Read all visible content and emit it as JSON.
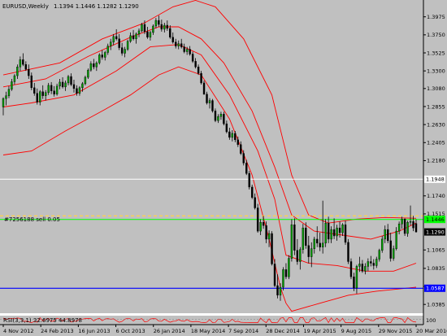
{
  "header": {
    "symbol": "EURUSD,Weekly",
    "ohlc": "1.1394 1.1446 1.1282 1.1290"
  },
  "chart_data": {
    "type": "candlestick",
    "y_ticks": [
      "1.3975",
      "1.3750",
      "1.3525",
      "1.3300",
      "1.3080",
      "1.2855",
      "1.2630",
      "1.2405",
      "1.2180",
      "1.1740",
      "1.1515",
      "1.1065",
      "1.0835",
      "1.0610",
      "1.0385"
    ],
    "x_ticks": [
      "4 Nov 2012",
      "24 Feb 2013",
      "16 Jun 2013",
      "6 Oct 2013",
      "26 Jan 2014",
      "18 May 2014",
      "7 Sep 2014",
      "28 Dec 2014",
      "19 Apr 2015",
      "9 Aug 2015",
      "29 Nov 2015",
      "20 Mar 2016"
    ],
    "ylim": [
      1.0265,
      1.4185
    ],
    "candles": [
      [
        1.285,
        1.297,
        1.2745,
        1.2955
      ],
      [
        1.2955,
        1.304,
        1.287,
        1.299
      ],
      [
        1.299,
        1.311,
        1.296,
        1.307
      ],
      [
        1.307,
        1.32,
        1.305,
        1.3165
      ],
      [
        1.3165,
        1.326,
        1.313,
        1.324
      ],
      [
        1.324,
        1.338,
        1.32,
        1.335
      ],
      [
        1.335,
        1.348,
        1.33,
        1.344
      ],
      [
        1.344,
        1.352,
        1.336,
        1.338
      ],
      [
        1.338,
        1.342,
        1.33,
        1.332
      ],
      [
        1.332,
        1.338,
        1.32,
        1.324
      ],
      [
        1.324,
        1.328,
        1.306,
        1.309
      ],
      [
        1.309,
        1.315,
        1.299,
        1.302
      ],
      [
        1.302,
        1.308,
        1.288,
        1.291
      ],
      [
        1.291,
        1.306,
        1.287,
        1.304
      ],
      [
        1.304,
        1.312,
        1.295,
        1.299
      ],
      [
        1.299,
        1.306,
        1.293,
        1.303
      ],
      [
        1.303,
        1.315,
        1.3,
        1.312
      ],
      [
        1.312,
        1.316,
        1.301,
        1.305
      ],
      [
        1.305,
        1.311,
        1.298,
        1.301
      ],
      [
        1.301,
        1.314,
        1.299,
        1.311
      ],
      [
        1.311,
        1.32,
        1.307,
        1.316
      ],
      [
        1.316,
        1.322,
        1.308,
        1.31
      ],
      [
        1.31,
        1.318,
        1.305,
        1.315
      ],
      [
        1.315,
        1.325,
        1.312,
        1.323
      ],
      [
        1.323,
        1.327,
        1.311,
        1.313
      ],
      [
        1.313,
        1.319,
        1.303,
        1.308
      ],
      [
        1.308,
        1.312,
        1.299,
        1.302
      ],
      [
        1.302,
        1.311,
        1.299,
        1.309
      ],
      [
        1.309,
        1.316,
        1.304,
        1.314
      ],
      [
        1.314,
        1.324,
        1.312,
        1.322
      ],
      [
        1.322,
        1.333,
        1.32,
        1.331
      ],
      [
        1.331,
        1.342,
        1.329,
        1.339
      ],
      [
        1.339,
        1.345,
        1.332,
        1.335
      ],
      [
        1.335,
        1.342,
        1.33,
        1.34
      ],
      [
        1.34,
        1.352,
        1.338,
        1.35
      ],
      [
        1.35,
        1.356,
        1.344,
        1.347
      ],
      [
        1.347,
        1.355,
        1.343,
        1.353
      ],
      [
        1.353,
        1.364,
        1.35,
        1.361
      ],
      [
        1.361,
        1.37,
        1.356,
        1.366
      ],
      [
        1.366,
        1.376,
        1.362,
        1.373
      ],
      [
        1.373,
        1.382,
        1.368,
        1.37
      ],
      [
        1.37,
        1.376,
        1.356,
        1.359
      ],
      [
        1.359,
        1.365,
        1.349,
        1.352
      ],
      [
        1.352,
        1.36,
        1.347,
        1.357
      ],
      [
        1.357,
        1.369,
        1.355,
        1.367
      ],
      [
        1.367,
        1.378,
        1.365,
        1.374
      ],
      [
        1.374,
        1.381,
        1.368,
        1.37
      ],
      [
        1.37,
        1.378,
        1.364,
        1.376
      ],
      [
        1.376,
        1.383,
        1.372,
        1.38
      ],
      [
        1.38,
        1.39,
        1.378,
        1.388
      ],
      [
        1.388,
        1.393,
        1.376,
        1.379
      ],
      [
        1.379,
        1.385,
        1.37,
        1.372
      ],
      [
        1.372,
        1.38,
        1.368,
        1.378
      ],
      [
        1.378,
        1.388,
        1.375,
        1.386
      ],
      [
        1.386,
        1.396,
        1.383,
        1.393
      ],
      [
        1.393,
        1.399,
        1.385,
        1.388
      ],
      [
        1.388,
        1.394,
        1.379,
        1.382
      ],
      [
        1.382,
        1.39,
        1.378,
        1.387
      ],
      [
        1.387,
        1.393,
        1.38,
        1.383
      ],
      [
        1.383,
        1.387,
        1.37,
        1.372
      ],
      [
        1.372,
        1.378,
        1.364,
        1.366
      ],
      [
        1.366,
        1.37,
        1.358,
        1.361
      ],
      [
        1.361,
        1.368,
        1.357,
        1.364
      ],
      [
        1.364,
        1.37,
        1.358,
        1.36
      ],
      [
        1.36,
        1.364,
        1.352,
        1.354
      ],
      [
        1.354,
        1.36,
        1.35,
        1.357
      ],
      [
        1.357,
        1.361,
        1.349,
        1.351
      ],
      [
        1.351,
        1.354,
        1.34,
        1.342
      ],
      [
        1.342,
        1.346,
        1.333,
        1.335
      ],
      [
        1.335,
        1.338,
        1.325,
        1.327
      ],
      [
        1.327,
        1.33,
        1.313,
        1.315
      ],
      [
        1.315,
        1.318,
        1.3,
        1.301
      ],
      [
        1.301,
        1.304,
        1.288,
        1.29
      ],
      [
        1.29,
        1.296,
        1.283,
        1.293
      ],
      [
        1.293,
        1.295,
        1.278,
        1.28
      ],
      [
        1.28,
        1.283,
        1.266,
        1.268
      ],
      [
        1.268,
        1.276,
        1.265,
        1.273
      ],
      [
        1.273,
        1.279,
        1.269,
        1.276
      ],
      [
        1.276,
        1.279,
        1.262,
        1.264
      ],
      [
        1.264,
        1.268,
        1.252,
        1.254
      ],
      [
        1.254,
        1.259,
        1.244,
        1.247
      ],
      [
        1.247,
        1.256,
        1.242,
        1.252
      ],
      [
        1.252,
        1.255,
        1.241,
        1.244
      ],
      [
        1.244,
        1.248,
        1.235,
        1.238
      ],
      [
        1.238,
        1.242,
        1.225,
        1.227
      ],
      [
        1.227,
        1.231,
        1.212,
        1.215
      ],
      [
        1.215,
        1.219,
        1.2,
        1.202
      ],
      [
        1.202,
        1.205,
        1.182,
        1.185
      ],
      [
        1.185,
        1.188,
        1.17,
        1.172
      ],
      [
        1.172,
        1.177,
        1.157,
        1.159
      ],
      [
        1.159,
        1.164,
        1.128,
        1.13
      ],
      [
        1.13,
        1.145,
        1.125,
        1.141
      ],
      [
        1.141,
        1.149,
        1.133,
        1.137
      ],
      [
        1.137,
        1.142,
        1.115,
        1.12
      ],
      [
        1.12,
        1.131,
        1.11,
        1.127
      ],
      [
        1.127,
        1.13,
        1.087,
        1.089
      ],
      [
        1.089,
        1.095,
        1.06,
        1.062
      ],
      [
        1.062,
        1.076,
        1.046,
        1.05
      ],
      [
        1.05,
        1.065,
        1.043,
        1.06
      ],
      [
        1.06,
        1.085,
        1.056,
        1.082
      ],
      [
        1.082,
        1.09,
        1.07,
        1.073
      ],
      [
        1.073,
        1.1,
        1.07,
        1.096
      ],
      [
        1.096,
        1.145,
        1.092,
        1.138
      ],
      [
        1.138,
        1.146,
        1.1,
        1.106
      ],
      [
        1.106,
        1.12,
        1.088,
        1.092
      ],
      [
        1.092,
        1.11,
        1.082,
        1.107
      ],
      [
        1.107,
        1.139,
        1.102,
        1.134
      ],
      [
        1.134,
        1.141,
        1.108,
        1.112
      ],
      [
        1.112,
        1.124,
        1.09,
        1.098
      ],
      [
        1.098,
        1.116,
        1.085,
        1.108
      ],
      [
        1.108,
        1.123,
        1.102,
        1.12
      ],
      [
        1.12,
        1.136,
        1.11,
        1.115
      ],
      [
        1.115,
        1.128,
        1.105,
        1.11
      ],
      [
        1.11,
        1.168,
        1.102,
        1.115
      ],
      [
        1.115,
        1.145,
        1.11,
        1.14
      ],
      [
        1.14,
        1.148,
        1.115,
        1.12
      ],
      [
        1.12,
        1.136,
        1.115,
        1.132
      ],
      [
        1.132,
        1.146,
        1.12,
        1.124
      ],
      [
        1.124,
        1.138,
        1.118,
        1.134
      ],
      [
        1.134,
        1.142,
        1.122,
        1.128
      ],
      [
        1.128,
        1.14,
        1.124,
        1.138
      ],
      [
        1.138,
        1.143,
        1.113,
        1.116
      ],
      [
        1.116,
        1.12,
        1.089,
        1.092
      ],
      [
        1.092,
        1.096,
        1.07,
        1.073
      ],
      [
        1.073,
        1.078,
        1.055,
        1.059
      ],
      [
        1.059,
        1.088,
        1.052,
        1.086
      ],
      [
        1.086,
        1.098,
        1.079,
        1.089
      ],
      [
        1.089,
        1.094,
        1.078,
        1.08
      ],
      [
        1.08,
        1.09,
        1.076,
        1.086
      ],
      [
        1.086,
        1.096,
        1.08,
        1.092
      ],
      [
        1.092,
        1.099,
        1.086,
        1.09
      ],
      [
        1.09,
        1.095,
        1.082,
        1.087
      ],
      [
        1.087,
        1.098,
        1.084,
        1.095
      ],
      [
        1.095,
        1.108,
        1.092,
        1.106
      ],
      [
        1.106,
        1.124,
        1.103,
        1.12
      ],
      [
        1.12,
        1.137,
        1.115,
        1.132
      ],
      [
        1.132,
        1.139,
        1.115,
        1.118
      ],
      [
        1.118,
        1.128,
        1.092,
        1.096
      ],
      [
        1.096,
        1.112,
        1.093,
        1.108
      ],
      [
        1.108,
        1.135,
        1.106,
        1.13
      ],
      [
        1.13,
        1.142,
        1.126,
        1.139
      ],
      [
        1.139,
        1.148,
        1.133,
        1.145
      ],
      [
        1.145,
        1.146,
        1.124,
        1.127
      ],
      [
        1.127,
        1.143,
        1.123,
        1.141
      ],
      [
        1.141,
        1.162,
        1.137,
        1.142
      ],
      [
        1.142,
        1.149,
        1.13,
        1.134
      ],
      [
        1.1394,
        1.1446,
        1.1282,
        1.129
      ]
    ],
    "bands": {
      "color": "#ff0000",
      "outer_upper": [
        [
          0,
          1.325
        ],
        [
          20,
          1.34
        ],
        [
          35,
          1.37
        ],
        [
          50,
          1.39
        ],
        [
          60,
          1.41
        ],
        [
          68,
          1.418
        ],
        [
          75,
          1.41
        ],
        [
          85,
          1.37
        ],
        [
          95,
          1.3
        ],
        [
          102,
          1.2
        ],
        [
          108,
          1.15
        ],
        [
          115,
          1.14
        ],
        [
          125,
          1.145
        ],
        [
          135,
          1.147
        ],
        [
          146,
          1.146
        ]
      ],
      "inner_upper": [
        [
          0,
          1.31
        ],
        [
          15,
          1.32
        ],
        [
          30,
          1.348
        ],
        [
          45,
          1.372
        ],
        [
          55,
          1.385
        ],
        [
          62,
          1.385
        ],
        [
          70,
          1.37
        ],
        [
          78,
          1.34
        ],
        [
          88,
          1.28
        ],
        [
          96,
          1.21
        ],
        [
          102,
          1.15
        ],
        [
          110,
          1.13
        ],
        [
          120,
          1.125
        ],
        [
          130,
          1.12
        ],
        [
          140,
          1.13
        ],
        [
          146,
          1.14
        ]
      ],
      "inner_lower": [
        [
          0,
          1.285
        ],
        [
          10,
          1.29
        ],
        [
          25,
          1.3
        ],
        [
          40,
          1.33
        ],
        [
          52,
          1.36
        ],
        [
          62,
          1.363
        ],
        [
          70,
          1.35
        ],
        [
          80,
          1.3
        ],
        [
          90,
          1.23
        ],
        [
          96,
          1.17
        ],
        [
          100,
          1.1
        ],
        [
          108,
          1.09
        ],
        [
          118,
          1.087
        ],
        [
          128,
          1.08
        ],
        [
          138,
          1.08
        ],
        [
          146,
          1.09
        ]
      ],
      "outer_lower": [
        [
          0,
          1.225
        ],
        [
          10,
          1.23
        ],
        [
          22,
          1.255
        ],
        [
          35,
          1.28
        ],
        [
          45,
          1.3
        ],
        [
          55,
          1.325
        ],
        [
          62,
          1.335
        ],
        [
          70,
          1.325
        ],
        [
          80,
          1.27
        ],
        [
          88,
          1.2
        ],
        [
          94,
          1.12
        ],
        [
          98,
          1.06
        ],
        [
          100,
          1.04
        ],
        [
          102,
          1.03
        ],
        [
          112,
          1.04
        ],
        [
          122,
          1.05
        ],
        [
          132,
          1.055
        ],
        [
          146,
          1.06
        ]
      ]
    },
    "lines": {
      "white_level": 1.1948,
      "green_level": 1.1446,
      "blue_level": 1.0587,
      "yellow_dashed": 1.149
    },
    "price_labels": {
      "white": "1.1948",
      "green": "1.1446",
      "current": "1.1290",
      "blue": "1.0587"
    },
    "trade_label": "#7256188 sell 0.05",
    "indicator_label": "RSI(3,3,1) 32.6975 44.8978",
    "indicator_scale_label": "100"
  }
}
